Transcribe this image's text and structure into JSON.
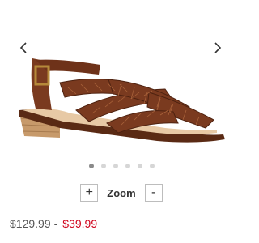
{
  "gallery": {
    "image_subject": "brown woven leather slingback sandal",
    "prev_icon": "chevron-left-icon",
    "next_icon": "chevron-right-icon",
    "dots_total": 6,
    "dots_active_index": 0
  },
  "zoom": {
    "plus_label": "+",
    "label": "Zoom",
    "minus_label": "-"
  },
  "price": {
    "original": "$129.99",
    "separator": "-",
    "sale": "$39.99"
  },
  "colors": {
    "sale_price": "#d0021b",
    "leather": "#7a3a1f",
    "heel_wood": "#b88a5c"
  }
}
